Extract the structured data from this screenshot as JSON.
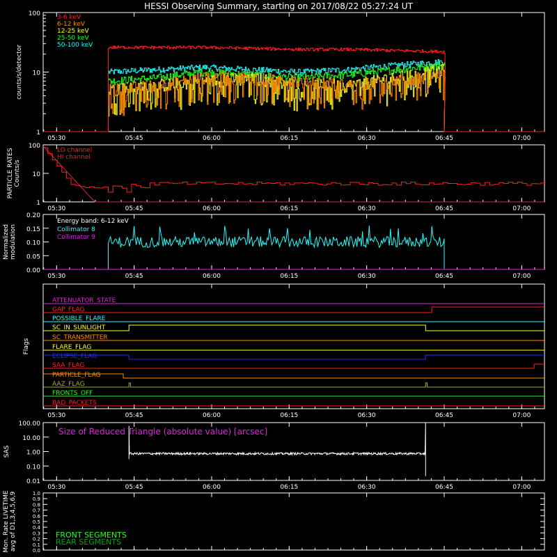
{
  "title": "HESSI Observing Summary, starting on 2017/08/22 05:27:24 UT",
  "time_ticks": [
    "05:30",
    "05:45",
    "06:00",
    "06:15",
    "06:30",
    "06:45",
    "07:00"
  ],
  "colors": {
    "red": "#ff2020",
    "orange": "#ff8c00",
    "yellow": "#ffff20",
    "green": "#20ff20",
    "cyan": "#20ffff",
    "magenta": "#e020e0",
    "white": "#ffffff",
    "blue": "#2030ff",
    "olive": "#b0b000",
    "darkgreen": "#10a010"
  },
  "chart_data": [
    {
      "id": "counts",
      "type": "line",
      "ylabel": "counts/s/detector",
      "yscale": "log",
      "ylim": [
        1,
        100
      ],
      "ytick_labels": [
        "1",
        "10",
        "100"
      ],
      "xlim_minutes": [
        0,
        97
      ],
      "series": [
        {
          "name": "3-6 keV",
          "color": "#ff2020",
          "before": 1,
          "level": [
            26,
            26,
            26,
            25,
            24,
            24,
            23,
            22
          ],
          "noise": 0.06,
          "after": 1
        },
        {
          "name": "6-12 keV",
          "color": "#ff8c00",
          "before": 1,
          "level": [
            5,
            6,
            8,
            8,
            7,
            6,
            7,
            9
          ],
          "noise": 0.25,
          "after": 1
        },
        {
          "name": "12-25 keV",
          "color": "#ffff20",
          "before": 1,
          "level": [
            5,
            6,
            7,
            8,
            6,
            6,
            8,
            11
          ],
          "noise": 0.25,
          "after": 1
        },
        {
          "name": "25-50 keV",
          "color": "#20ff20",
          "before": 1,
          "level": [
            7,
            8,
            10,
            9,
            8,
            9,
            11,
            13
          ],
          "noise": 0.15,
          "after": 1
        },
        {
          "name": "50-100 keV",
          "color": "#20ffff",
          "before": 1,
          "level": [
            10,
            11,
            12,
            11,
            10,
            11,
            13,
            15
          ],
          "noise": 0.12,
          "after": 1
        }
      ],
      "start_min": 12.6,
      "end_min": 77.6
    },
    {
      "id": "particle",
      "type": "line",
      "ylabel": [
        "PARTICLE RATES",
        "Counts/s"
      ],
      "yscale": "log",
      "ylim": [
        1,
        100
      ],
      "ytick_labels": [
        "1",
        "10",
        "100"
      ],
      "series": [
        {
          "name": "LO channel",
          "color": "#ff2020"
        },
        {
          "name": "HI channel",
          "color": "#e02040"
        }
      ]
    },
    {
      "id": "modulation",
      "type": "line",
      "ylabel": [
        "Normalized",
        "modulation"
      ],
      "ylim": [
        0,
        0.2
      ],
      "ytick_labels": [
        "0.00",
        "0.05",
        "0.10",
        "0.15",
        "0.20"
      ],
      "annotation": "Energy band: 6-12 keV",
      "series": [
        {
          "name": "Collimator 8",
          "color": "#20ffff",
          "level": 0.1
        },
        {
          "name": "Collimator 9",
          "color": "#e020e0",
          "level": 0.0
        }
      ]
    },
    {
      "id": "flags",
      "type": "line",
      "ylabel": "Flags",
      "flags": [
        {
          "name": "ATTENUATOR_STATE",
          "color": "#e020e0"
        },
        {
          "name": "GAP_FLAG",
          "color": "#ff2020"
        },
        {
          "name": "POSSIBLE_FLARE",
          "color": "#20ffff"
        },
        {
          "name": "SC_IN_SUNLIGHT",
          "color": "#ffff20"
        },
        {
          "name": "SC_TRANSMITTER",
          "color": "#ff8c00"
        },
        {
          "name": "FLARE_FLAG",
          "color": "#ffff20"
        },
        {
          "name": "ECLIPSE_FLAG",
          "color": "#2030ff"
        },
        {
          "name": "SAA_FLAG",
          "color": "#ff2020"
        },
        {
          "name": "PARTICLE_FLAG",
          "color": "#ff8c00"
        },
        {
          "name": "AAZ_FLAG",
          "color": "#b0b000"
        },
        {
          "name": "FRONTS_OFF",
          "color": "#20ff20"
        },
        {
          "name": "BAD_PACKETS",
          "color": "#ff2020"
        }
      ]
    },
    {
      "id": "sas",
      "type": "line",
      "ylabel": "SAS",
      "yscale": "log",
      "ylim": [
        0.01,
        100
      ],
      "ytick_labels": [
        "0.01",
        "0.10",
        "1.00",
        "10.00",
        "100.00"
      ],
      "annotation": "Size of Reduced Triangle (absolute value) [arcsec]",
      "series": [
        {
          "name": "",
          "color": "#ffffff",
          "level": 0.7
        }
      ]
    },
    {
      "id": "livetime",
      "type": "line",
      "ylabel": [
        "Mon. Rate LIVETIME",
        "avg of D1,3,4,5,6,9"
      ],
      "ylim": [
        0,
        1
      ],
      "ytick_labels": [
        "0.0",
        "0.1",
        "0.2",
        "0.3",
        "0.4",
        "0.5",
        "0.6",
        "0.7",
        "0.8",
        "0.9",
        "1.0"
      ],
      "legend": [
        {
          "name": "FRONT SEGMENTS",
          "color": "#20ff20"
        },
        {
          "name": "REAR SEGMENTS",
          "color": "#10a010"
        }
      ]
    }
  ]
}
